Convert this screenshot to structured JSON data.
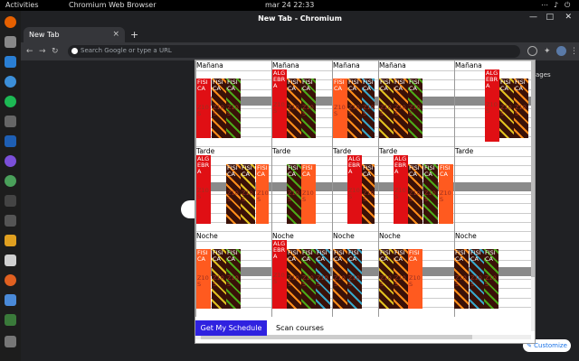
{
  "system": {
    "activities": "Activities",
    "app_name": "Chromium Web Browser",
    "clock": "mar 24  22:33"
  },
  "window": {
    "title": "New Tab - Chromium"
  },
  "tabs": [
    {
      "label": "New Tab"
    }
  ],
  "omnibox": {
    "placeholder": "Search Google or type a URL"
  },
  "page": {
    "images_label": "Images",
    "customize_label": "Customize"
  },
  "extension": {
    "periods": [
      "Mañana",
      "Tarde",
      "Noche"
    ],
    "buttons": {
      "get_schedule": "Get My Schedule",
      "scan_courses": "Scan courses"
    },
    "course_names": {
      "fisica": "FISI CA",
      "algebra": "ALG EBR A"
    },
    "sub_text": "Z10 S"
  },
  "colors": {
    "accent_button": "#2f22e0",
    "red": "#e00f14",
    "orange": "#ff5a1f",
    "dark": "#3a1108"
  }
}
